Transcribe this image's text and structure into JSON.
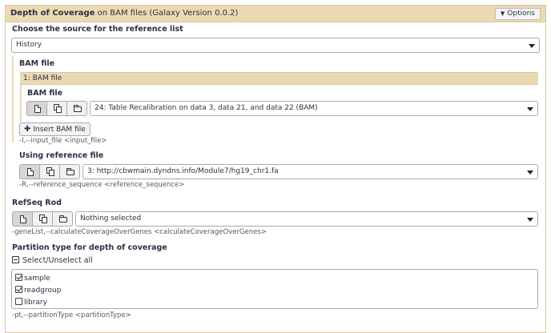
{
  "header": {
    "tool_name": "Depth of Coverage",
    "tool_suffix": "on BAM files (Galaxy Version 0.0.2)",
    "options_label": "Options"
  },
  "reference_source": {
    "label": "Choose the source for the reference list",
    "value": "History"
  },
  "bam_section": {
    "label": "BAM file",
    "repeat_title": "1: BAM file",
    "field_label": "BAM file",
    "value": "24: Table Recalibration on data 3, data 21, and data 22 (BAM)",
    "insert_label": "Insert BAM file",
    "help": "-I,--input_file <input_file>"
  },
  "reference": {
    "label": "Using reference file",
    "value": "3: http://cbwmain.dyndns.info/Module7/hg19_chr1.fa",
    "help": "-R,--reference_sequence <reference_sequence>"
  },
  "refseq": {
    "label": "RefSeq Rod",
    "value": "Nothing selected",
    "help": "-geneList,--calculateCoverageOverGenes <calculateCoverageOverGenes>"
  },
  "partition": {
    "label": "Partition type for depth of coverage",
    "select_all_label": "Select/Unselect all",
    "options": [
      {
        "label": "sample",
        "checked": true
      },
      {
        "label": "readgroup",
        "checked": true
      },
      {
        "label": "library",
        "checked": false
      }
    ],
    "help": "-pt,--partitionType <partitionType>"
  }
}
